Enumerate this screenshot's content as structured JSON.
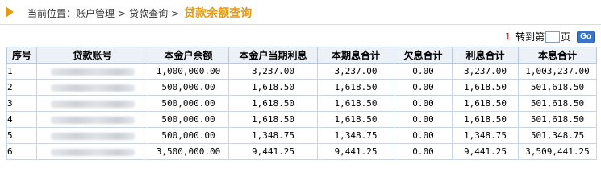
{
  "breadcrumb": {
    "prefix": "当前位置：",
    "level1": "账户管理",
    "level2": "贷款查询",
    "current": "贷款余额查询",
    "separator": ">"
  },
  "pager": {
    "current_page": "1",
    "goto_label": "转到第",
    "page_unit": "页",
    "go_label": "Go"
  },
  "table": {
    "headers": [
      "序号",
      "贷款账号",
      "本金户余额",
      "本金户当期利息",
      "本期息合计",
      "欠息合计",
      "利息合计",
      "本息合计"
    ],
    "rows": [
      {
        "idx": "1",
        "principal": "1,000,000.00",
        "period_interest": "3,237.00",
        "period_total": "3,237.00",
        "overdue": "0.00",
        "interest_total": "3,237.00",
        "grand_total": "1,003,237.00"
      },
      {
        "idx": "2",
        "principal": "500,000.00",
        "period_interest": "1,618.50",
        "period_total": "1,618.50",
        "overdue": "0.00",
        "interest_total": "1,618.50",
        "grand_total": "501,618.50"
      },
      {
        "idx": "3",
        "principal": "500,000.00",
        "period_interest": "1,618.50",
        "period_total": "1,618.50",
        "overdue": "0.00",
        "interest_total": "1,618.50",
        "grand_total": "501,618.50"
      },
      {
        "idx": "4",
        "principal": "500,000.00",
        "period_interest": "1,618.50",
        "period_total": "1,618.50",
        "overdue": "0.00",
        "interest_total": "1,618.50",
        "grand_total": "501,618.50"
      },
      {
        "idx": "5",
        "principal": "500,000.00",
        "period_interest": "1,348.75",
        "period_total": "1,348.75",
        "overdue": "0.00",
        "interest_total": "1,348.75",
        "grand_total": "501,348.75"
      },
      {
        "idx": "6",
        "principal": "3,500,000.00",
        "period_interest": "9,441.25",
        "period_total": "9,441.25",
        "overdue": "0.00",
        "interest_total": "9,441.25",
        "grand_total": "3,509,441.25"
      }
    ]
  },
  "colors": {
    "accent": "#e49b0f",
    "header_bg": "#ebf1f7",
    "border": "#b9c9da",
    "page_number": "#cc0000",
    "go_button": "#3a74c4"
  },
  "icons": {
    "breadcrumb_marker": "orange-triangle-icon"
  }
}
